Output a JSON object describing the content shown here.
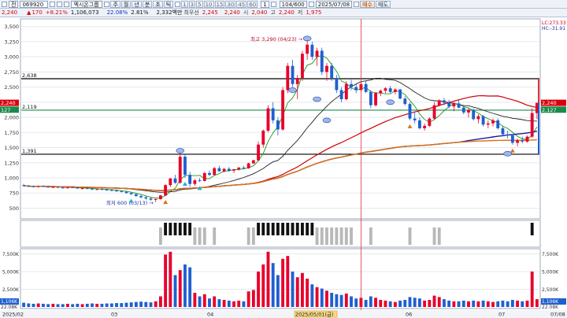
{
  "toolbar": {
    "market": "전",
    "code": "069920",
    "name": "엑시온그룹",
    "periods": [
      "주",
      "월",
      "년",
      "분",
      "초",
      "틱"
    ],
    "minutes": [
      "1",
      "3",
      "5",
      "10",
      "15",
      "30",
      "45",
      "60"
    ],
    "interval": "1",
    "count": "104/600",
    "date": "2025/07/08",
    "sell_label": "매수",
    "buy_label": "매도"
  },
  "quote": {
    "price": "2,240",
    "change": "170",
    "change_pct": "+8.21%",
    "volume": "1,106,073",
    "vol_ratio": "22.08%",
    "turnover": "2.81%",
    "amount_label": "2,332백만",
    "prev_label": "최우선",
    "bid": "2,245",
    "ask": "2,240",
    "open_label": "시",
    "open": "2,040",
    "high_label": "고",
    "high": "2,240",
    "low_label": "저",
    "low": "1,975"
  },
  "price_panel": {
    "ticks": [
      "3,500",
      "3,250",
      "3,000",
      "2,750",
      "2,500",
      "2,250",
      "2,000",
      "1,750",
      "1,500",
      "1,250",
      "1,000",
      "750",
      "500"
    ],
    "hline_upper_label": "2,638",
    "hline_mid_label": "2,119",
    "hline_lower_label": "1,391",
    "peak_label": "최고 3,290 (04/23)",
    "trough_label": "최저 600 (03/13)",
    "right_badge_price": "2,240",
    "right_badge_avg": "2,127",
    "right_left_badge": "2,240",
    "right_left_badge2": "127",
    "ma_labels": [
      "LC:273.33",
      "HC:-31.91"
    ],
    "ma_colors": {
      "ma5": "#1b9a1b",
      "ma20": "#222222",
      "ma60": "#cc0000",
      "ma120": "#1a1aa0",
      "ma240": "#e07010"
    },
    "up_color": "#e8002a",
    "down_color": "#1f5fd0"
  },
  "volume_panel": {
    "ticks": [
      "7,500K",
      "5,000K",
      "2,500K"
    ],
    "right_ticks": [
      "7,500K",
      "5,000K",
      "2,500K"
    ],
    "left_badge": "1,106K",
    "right_badge": "1,106K",
    "left_badge2": "22.08K",
    "right_badge2": "22.08K"
  },
  "x_axis": {
    "labels": [
      "2025/02",
      "03",
      "04",
      "2025/05/01(금)",
      "06",
      "07",
      "07/08"
    ],
    "cursor_label": "2025/05/01(금)"
  },
  "chart_data": {
    "type": "candlestick",
    "notes": "Daily OHLC candles, 2025/02 to 2025/07/08, values estimated from axes",
    "ylim": [
      350,
      3600
    ],
    "volume_ylim": [
      0,
      8000
    ],
    "candles": [
      [
        880,
        900,
        860,
        870,
        600
      ],
      [
        870,
        880,
        850,
        860,
        500
      ],
      [
        860,
        875,
        845,
        850,
        450
      ],
      [
        850,
        870,
        840,
        865,
        500
      ],
      [
        865,
        880,
        850,
        855,
        450
      ],
      [
        855,
        870,
        840,
        845,
        400
      ],
      [
        845,
        860,
        830,
        850,
        450
      ],
      [
        850,
        865,
        835,
        840,
        400
      ],
      [
        840,
        855,
        825,
        835,
        400
      ],
      [
        835,
        850,
        820,
        845,
        450
      ],
      [
        845,
        860,
        830,
        840,
        400
      ],
      [
        840,
        850,
        820,
        825,
        450
      ],
      [
        825,
        840,
        810,
        830,
        400
      ],
      [
        830,
        845,
        815,
        820,
        450
      ],
      [
        820,
        835,
        800,
        810,
        500
      ],
      [
        810,
        825,
        795,
        815,
        450
      ],
      [
        815,
        830,
        800,
        805,
        450
      ],
      [
        805,
        820,
        790,
        800,
        500
      ],
      [
        800,
        815,
        780,
        790,
        500
      ],
      [
        790,
        805,
        770,
        780,
        550
      ],
      [
        780,
        795,
        760,
        770,
        550
      ],
      [
        770,
        785,
        740,
        750,
        600
      ],
      [
        750,
        765,
        720,
        730,
        650
      ],
      [
        730,
        745,
        690,
        700,
        700
      ],
      [
        700,
        720,
        660,
        680,
        750
      ],
      [
        680,
        700,
        640,
        660,
        700
      ],
      [
        660,
        680,
        620,
        640,
        650
      ],
      [
        640,
        660,
        600,
        650,
        800
      ],
      [
        650,
        720,
        640,
        710,
        1500
      ],
      [
        710,
        900,
        700,
        880,
        7400
      ],
      [
        880,
        1000,
        850,
        990,
        7800
      ],
      [
        990,
        1050,
        900,
        920,
        4500
      ],
      [
        920,
        1490,
        900,
        1350,
        5200
      ],
      [
        1350,
        1400,
        1000,
        1050,
        6000
      ],
      [
        1050,
        1100,
        850,
        900,
        5600
      ],
      [
        900,
        980,
        870,
        960,
        2000
      ],
      [
        960,
        1000,
        930,
        950,
        1500
      ],
      [
        950,
        1100,
        940,
        1080,
        1800
      ],
      [
        1080,
        1120,
        1030,
        1050,
        1200
      ],
      [
        1050,
        1180,
        1040,
        1160,
        1500
      ],
      [
        1160,
        1200,
        1100,
        1110,
        1100
      ],
      [
        1110,
        1160,
        1090,
        1150,
        1000
      ],
      [
        1150,
        1180,
        1100,
        1120,
        900
      ],
      [
        1120,
        1150,
        1080,
        1140,
        800
      ],
      [
        1140,
        1180,
        1120,
        1170,
        900
      ],
      [
        1170,
        1200,
        1150,
        1160,
        800
      ],
      [
        1160,
        1250,
        1150,
        1240,
        2200
      ],
      [
        1240,
        1300,
        1230,
        1290,
        2400
      ],
      [
        1290,
        1600,
        1280,
        1550,
        5000
      ],
      [
        1550,
        1800,
        1500,
        1780,
        6000
      ],
      [
        1780,
        2200,
        1750,
        2150,
        7800
      ],
      [
        2150,
        2250,
        1900,
        1950,
        6200
      ],
      [
        1950,
        2000,
        1700,
        1800,
        4500
      ],
      [
        1800,
        2500,
        1780,
        2450,
        6800
      ],
      [
        2450,
        2900,
        2400,
        2850,
        7200
      ],
      [
        2850,
        2950,
        2500,
        2550,
        5000
      ],
      [
        2550,
        2700,
        2300,
        2650,
        4200
      ],
      [
        2650,
        3100,
        2600,
        3050,
        4800
      ],
      [
        3050,
        3290,
        2950,
        3200,
        4000
      ],
      [
        3200,
        3250,
        2950,
        3000,
        3200
      ],
      [
        3000,
        3150,
        2850,
        3100,
        2800
      ],
      [
        3100,
        3150,
        2700,
        2750,
        2600
      ],
      [
        2750,
        2900,
        2600,
        2850,
        2300
      ],
      [
        2850,
        2900,
        2600,
        2650,
        2000
      ],
      [
        2650,
        2700,
        2400,
        2450,
        1800
      ],
      [
        2450,
        2500,
        2250,
        2300,
        1700
      ],
      [
        2300,
        2600,
        2280,
        2550,
        1900
      ],
      [
        2550,
        2620,
        2450,
        2500,
        1500
      ],
      [
        2500,
        2550,
        2400,
        2450,
        1200
      ],
      [
        2450,
        2600,
        2420,
        2550,
        1300
      ],
      [
        2550,
        2600,
        2400,
        2420,
        1000
      ],
      [
        2420,
        2450,
        2150,
        2200,
        1500
      ],
      [
        2200,
        2420,
        2180,
        2400,
        1300
      ],
      [
        2400,
        2460,
        2350,
        2440,
        1000
      ],
      [
        2440,
        2500,
        2400,
        2480,
        900
      ],
      [
        2480,
        2520,
        2400,
        2420,
        800
      ],
      [
        2420,
        2480,
        2380,
        2460,
        700
      ],
      [
        2460,
        2470,
        2300,
        2310,
        900
      ],
      [
        2310,
        2350,
        2200,
        2220,
        1000
      ],
      [
        2220,
        2250,
        1950,
        1980,
        1400
      ],
      [
        1980,
        2100,
        1900,
        1950,
        1300
      ],
      [
        1950,
        2000,
        1800,
        1820,
        1200
      ],
      [
        1820,
        1900,
        1780,
        1860,
        900
      ],
      [
        1860,
        2000,
        1840,
        1980,
        1000
      ],
      [
        1980,
        2250,
        1960,
        2200,
        1600
      ],
      [
        2200,
        2300,
        2180,
        2280,
        1400
      ],
      [
        2280,
        2320,
        2200,
        2240,
        1100
      ],
      [
        2240,
        2290,
        2150,
        2180,
        900
      ],
      [
        2180,
        2250,
        2100,
        2230,
        800
      ],
      [
        2230,
        2280,
        2150,
        2160,
        800
      ],
      [
        2160,
        2200,
        2050,
        2080,
        900
      ],
      [
        2080,
        2150,
        2000,
        2120,
        800
      ],
      [
        2120,
        2150,
        1950,
        1970,
        900
      ],
      [
        1970,
        2050,
        1900,
        2020,
        800
      ],
      [
        2020,
        2040,
        1850,
        1880,
        900
      ],
      [
        1880,
        1950,
        1820,
        1900,
        800
      ],
      [
        1900,
        1980,
        1850,
        1950,
        700
      ],
      [
        1950,
        1980,
        1800,
        1820,
        800
      ],
      [
        1820,
        1860,
        1700,
        1720,
        900
      ],
      [
        1720,
        1780,
        1650,
        1700,
        800
      ],
      [
        1700,
        1720,
        1550,
        1580,
        1000
      ],
      [
        1580,
        1650,
        1520,
        1620,
        900
      ],
      [
        1620,
        1680,
        1570,
        1600,
        800
      ],
      [
        1600,
        1700,
        1580,
        1680,
        900
      ],
      [
        1680,
        2150,
        1660,
        2070,
        5000
      ],
      [
        2070,
        2240,
        1975,
        2240,
        1100
      ]
    ]
  }
}
